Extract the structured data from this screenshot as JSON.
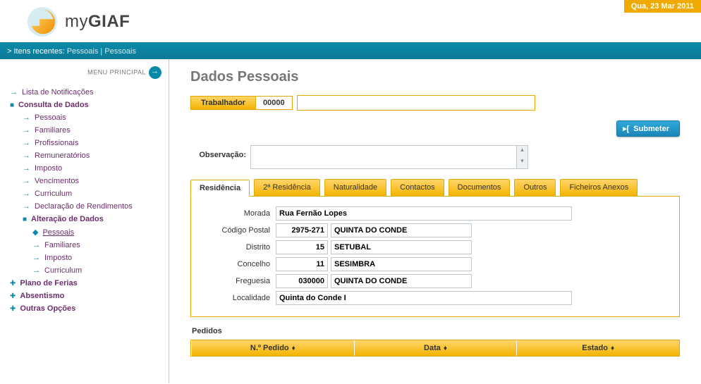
{
  "header": {
    "date": "Qua, 23 Mar 2011",
    "logo_prefix": "my",
    "logo_bold": "GIAF"
  },
  "breadcrumb": {
    "prefix": "> Itens recentes:",
    "items": [
      "Pessoais",
      "Pessoais"
    ]
  },
  "sidebar": {
    "menu_label": "MENU PRINCIPAL",
    "items": {
      "notificacoes": "Lista de Notificações",
      "consulta": "Consulta de Dados",
      "pessoais": "Pessoais",
      "familiares": "Familiares",
      "profissionais": "Profissionais",
      "remuneratorios": "Remuneratórios",
      "imposto": "Imposto",
      "vencimentos": "Vencimentos",
      "curriculum": "Curriculum",
      "declaracao": "Declaração de Rendimentos",
      "alteracao": "Alteração de Dados",
      "alt_pessoais": "Pessoais",
      "alt_familiares": "Familiares",
      "alt_imposto": "Imposto",
      "alt_curriculum": "Curriculum",
      "ferias": "Plano de Ferias",
      "absentismo": "Absentismo",
      "outras": "Outras Opções"
    }
  },
  "main": {
    "title": "Dados Pessoais",
    "worker_label": "Trabalhador",
    "worker_code": "00000",
    "submit": "Submeter",
    "obs_label": "Observação:",
    "tabs": {
      "residencia": "Residência",
      "residencia2": "2ª Residência",
      "naturalidade": "Naturalidade",
      "contactos": "Contactos",
      "documentos": "Documentos",
      "outros": "Outros",
      "ficheiros": "Ficheiros Anexos"
    },
    "fields": {
      "morada_lbl": "Morada",
      "morada": "Rua Fernão Lopes",
      "cp_lbl": "Código Postal",
      "cp_code": "2975-271",
      "cp_name": "QUINTA DO CONDE",
      "distrito_lbl": "Distrito",
      "distrito_code": "15",
      "distrito_name": "SETUBAL",
      "concelho_lbl": "Concelho",
      "concelho_code": "11",
      "concelho_name": "SESIMBRA",
      "freguesia_lbl": "Freguesia",
      "freguesia_code": "030000",
      "freguesia_name": "QUINTA DO CONDE",
      "localidade_lbl": "Localidade",
      "localidade": "Quinta do Conde I"
    },
    "pedidos_label": "Pedidos",
    "table": {
      "col1": "N.º Pedido",
      "col2": "Data",
      "col3": "Estado"
    }
  }
}
